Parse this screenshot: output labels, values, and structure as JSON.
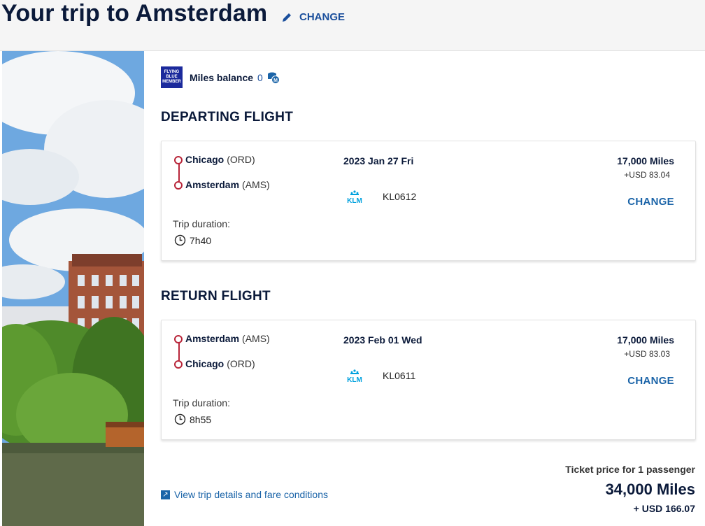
{
  "header": {
    "title": "Your trip to Amsterdam",
    "change_label": "CHANGE"
  },
  "miles": {
    "logo_text": "FLYING BLUE MEMBER",
    "label": "Miles balance",
    "value": "0"
  },
  "departing": {
    "title": "DEPARTING FLIGHT",
    "origin_city": "Chicago",
    "origin_code": "(ORD)",
    "dest_city": "Amsterdam",
    "dest_code": "(AMS)",
    "date": "2023 Jan 27 Fri",
    "airline": "KLM",
    "flight_number": "KL0612",
    "duration_label": "Trip duration:",
    "duration": "7h40",
    "price_miles": "17,000 Miles",
    "price_usd": "+USD 83.04",
    "change_label": "CHANGE"
  },
  "return": {
    "title": "RETURN FLIGHT",
    "origin_city": "Amsterdam",
    "origin_code": "(AMS)",
    "dest_city": "Chicago",
    "dest_code": "(ORD)",
    "date": "2023 Feb 01 Wed",
    "airline": "KLM",
    "flight_number": "KL0611",
    "duration_label": "Trip duration:",
    "duration": "8h55",
    "price_miles": "17,000 Miles",
    "price_usd": "+USD 83.03",
    "change_label": "CHANGE"
  },
  "footer": {
    "details_link": "View trip details and fare conditions",
    "ticket_label": "Ticket price for 1 passenger",
    "total_miles": "34,000 Miles",
    "total_usd": "+ USD 166.07"
  },
  "colors": {
    "navy": "#0b1a3a",
    "link_blue": "#1b64a8",
    "route_red": "#b8263a",
    "klm_blue": "#00a1de"
  },
  "icons": [
    "pencil-icon",
    "flying-blue-logo",
    "coins-icon",
    "klm-logo",
    "clock-icon",
    "external-link-icon"
  ]
}
